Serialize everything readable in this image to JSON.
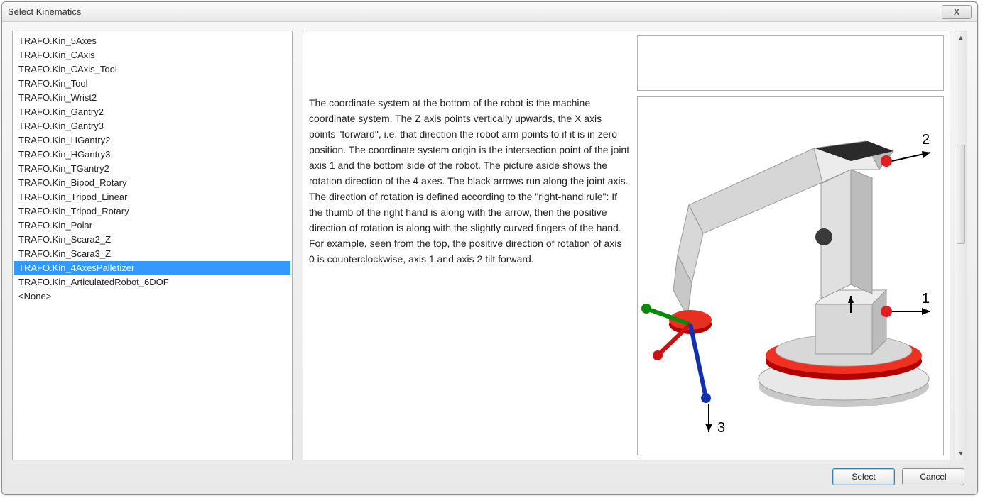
{
  "window": {
    "title": "Select Kinematics",
    "close_label": "X"
  },
  "list": {
    "items": [
      "TRAFO.Kin_5Axes",
      "TRAFO.Kin_CAxis",
      "TRAFO.Kin_CAxis_Tool",
      "TRAFO.Kin_Tool",
      "TRAFO.Kin_Wrist2",
      "TRAFO.Kin_Gantry2",
      "TRAFO.Kin_Gantry3",
      "TRAFO.Kin_HGantry2",
      "TRAFO.Kin_HGantry3",
      "TRAFO.Kin_TGantry2",
      "TRAFO.Kin_Bipod_Rotary",
      "TRAFO.Kin_Tripod_Linear",
      "TRAFO.Kin_Tripod_Rotary",
      "TRAFO.Kin_Polar",
      "TRAFO.Kin_Scara2_Z",
      "TRAFO.Kin_Scara3_Z",
      "TRAFO.Kin_4AxesPalletizer",
      "TRAFO.Kin_ArticulatedRobot_6DOF",
      "<None>"
    ],
    "selected_index": 16
  },
  "description": {
    "text": "The coordinate system at the bottom of the robot is the machine coordinate system. The Z axis points vertically upwards, the X axis points \"forward\", i.e. that direction the robot arm points to if it is in zero position. The coordinate system origin is the intersection point of the joint axis 1 and the bottom side of the robot. The picture aside shows the rotation direction of the 4 axes. The black arrows run along the joint axis. The direction of rotation is defined according to the \"right-hand rule\": If the thumb of the right hand is along with the arrow, then the positive direction of rotation is along with the slightly curved fingers of the hand. For example, seen from the top, the positive direction of rotation of axis 0 is counterclockwise, axis 1 and axis 2 tilt forward."
  },
  "image": {
    "axis_labels": {
      "a1": "1",
      "a2": "2",
      "a3": "3"
    }
  },
  "buttons": {
    "select": "Select",
    "cancel": "Cancel"
  }
}
